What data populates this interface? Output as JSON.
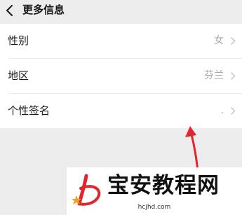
{
  "header": {
    "title": "更多信息",
    "back_icon": "chevron-left-icon"
  },
  "rows": [
    {
      "label": "性别",
      "value": "女"
    },
    {
      "label": "地区",
      "value": "芬兰"
    },
    {
      "label": "个性签名",
      "value": "."
    }
  ],
  "annotation": {
    "arrow_color": "#e0262c"
  },
  "watermark": {
    "text": "宝安教程网",
    "url": "hcjhd.com",
    "logo_color": "#e0262c"
  }
}
